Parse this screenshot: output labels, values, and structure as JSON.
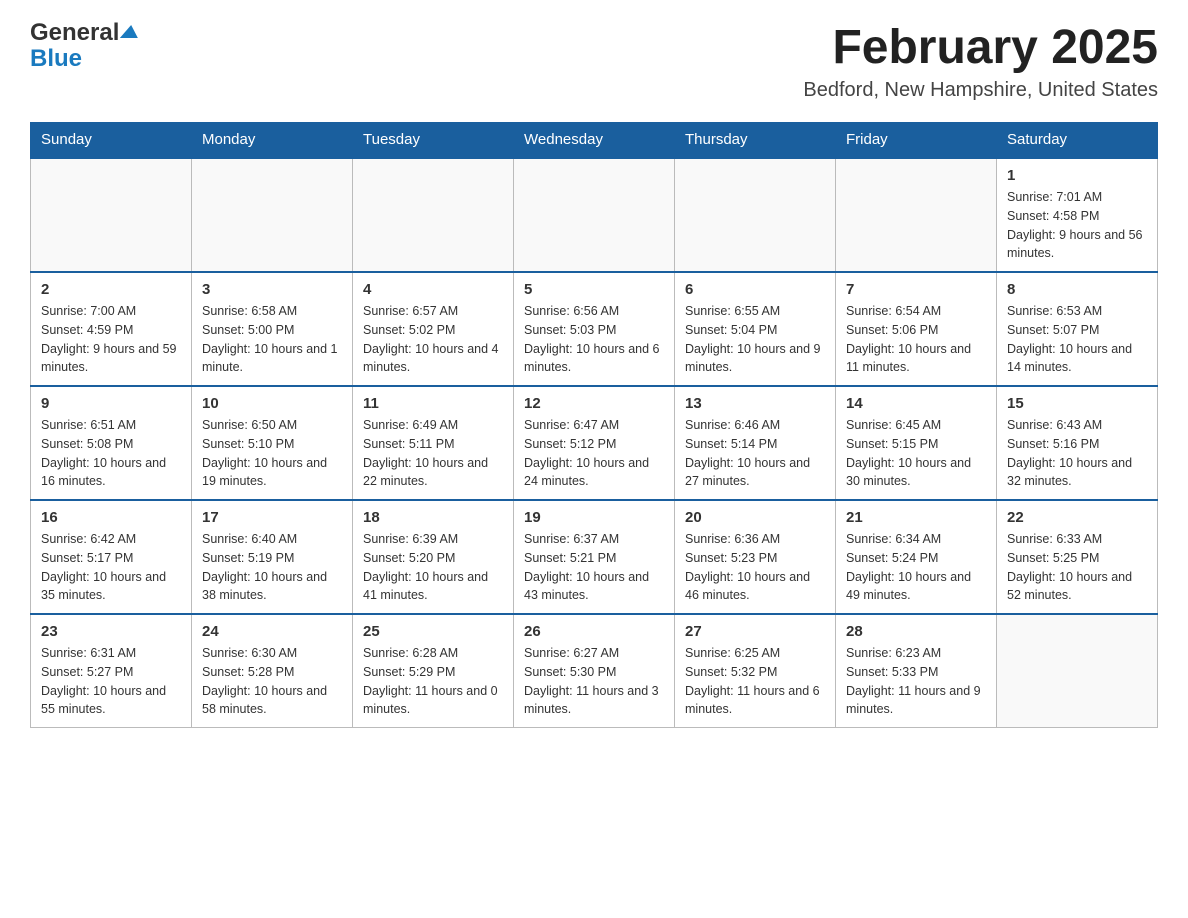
{
  "header": {
    "logo_general": "General",
    "logo_blue": "Blue",
    "month_title": "February 2025",
    "location": "Bedford, New Hampshire, United States"
  },
  "weekdays": [
    "Sunday",
    "Monday",
    "Tuesday",
    "Wednesday",
    "Thursday",
    "Friday",
    "Saturday"
  ],
  "weeks": [
    [
      {
        "day": "",
        "info": ""
      },
      {
        "day": "",
        "info": ""
      },
      {
        "day": "",
        "info": ""
      },
      {
        "day": "",
        "info": ""
      },
      {
        "day": "",
        "info": ""
      },
      {
        "day": "",
        "info": ""
      },
      {
        "day": "1",
        "info": "Sunrise: 7:01 AM\nSunset: 4:58 PM\nDaylight: 9 hours and 56 minutes."
      }
    ],
    [
      {
        "day": "2",
        "info": "Sunrise: 7:00 AM\nSunset: 4:59 PM\nDaylight: 9 hours and 59 minutes."
      },
      {
        "day": "3",
        "info": "Sunrise: 6:58 AM\nSunset: 5:00 PM\nDaylight: 10 hours and 1 minute."
      },
      {
        "day": "4",
        "info": "Sunrise: 6:57 AM\nSunset: 5:02 PM\nDaylight: 10 hours and 4 minutes."
      },
      {
        "day": "5",
        "info": "Sunrise: 6:56 AM\nSunset: 5:03 PM\nDaylight: 10 hours and 6 minutes."
      },
      {
        "day": "6",
        "info": "Sunrise: 6:55 AM\nSunset: 5:04 PM\nDaylight: 10 hours and 9 minutes."
      },
      {
        "day": "7",
        "info": "Sunrise: 6:54 AM\nSunset: 5:06 PM\nDaylight: 10 hours and 11 minutes."
      },
      {
        "day": "8",
        "info": "Sunrise: 6:53 AM\nSunset: 5:07 PM\nDaylight: 10 hours and 14 minutes."
      }
    ],
    [
      {
        "day": "9",
        "info": "Sunrise: 6:51 AM\nSunset: 5:08 PM\nDaylight: 10 hours and 16 minutes."
      },
      {
        "day": "10",
        "info": "Sunrise: 6:50 AM\nSunset: 5:10 PM\nDaylight: 10 hours and 19 minutes."
      },
      {
        "day": "11",
        "info": "Sunrise: 6:49 AM\nSunset: 5:11 PM\nDaylight: 10 hours and 22 minutes."
      },
      {
        "day": "12",
        "info": "Sunrise: 6:47 AM\nSunset: 5:12 PM\nDaylight: 10 hours and 24 minutes."
      },
      {
        "day": "13",
        "info": "Sunrise: 6:46 AM\nSunset: 5:14 PM\nDaylight: 10 hours and 27 minutes."
      },
      {
        "day": "14",
        "info": "Sunrise: 6:45 AM\nSunset: 5:15 PM\nDaylight: 10 hours and 30 minutes."
      },
      {
        "day": "15",
        "info": "Sunrise: 6:43 AM\nSunset: 5:16 PM\nDaylight: 10 hours and 32 minutes."
      }
    ],
    [
      {
        "day": "16",
        "info": "Sunrise: 6:42 AM\nSunset: 5:17 PM\nDaylight: 10 hours and 35 minutes."
      },
      {
        "day": "17",
        "info": "Sunrise: 6:40 AM\nSunset: 5:19 PM\nDaylight: 10 hours and 38 minutes."
      },
      {
        "day": "18",
        "info": "Sunrise: 6:39 AM\nSunset: 5:20 PM\nDaylight: 10 hours and 41 minutes."
      },
      {
        "day": "19",
        "info": "Sunrise: 6:37 AM\nSunset: 5:21 PM\nDaylight: 10 hours and 43 minutes."
      },
      {
        "day": "20",
        "info": "Sunrise: 6:36 AM\nSunset: 5:23 PM\nDaylight: 10 hours and 46 minutes."
      },
      {
        "day": "21",
        "info": "Sunrise: 6:34 AM\nSunset: 5:24 PM\nDaylight: 10 hours and 49 minutes."
      },
      {
        "day": "22",
        "info": "Sunrise: 6:33 AM\nSunset: 5:25 PM\nDaylight: 10 hours and 52 minutes."
      }
    ],
    [
      {
        "day": "23",
        "info": "Sunrise: 6:31 AM\nSunset: 5:27 PM\nDaylight: 10 hours and 55 minutes."
      },
      {
        "day": "24",
        "info": "Sunrise: 6:30 AM\nSunset: 5:28 PM\nDaylight: 10 hours and 58 minutes."
      },
      {
        "day": "25",
        "info": "Sunrise: 6:28 AM\nSunset: 5:29 PM\nDaylight: 11 hours and 0 minutes."
      },
      {
        "day": "26",
        "info": "Sunrise: 6:27 AM\nSunset: 5:30 PM\nDaylight: 11 hours and 3 minutes."
      },
      {
        "day": "27",
        "info": "Sunrise: 6:25 AM\nSunset: 5:32 PM\nDaylight: 11 hours and 6 minutes."
      },
      {
        "day": "28",
        "info": "Sunrise: 6:23 AM\nSunset: 5:33 PM\nDaylight: 11 hours and 9 minutes."
      },
      {
        "day": "",
        "info": ""
      }
    ]
  ]
}
